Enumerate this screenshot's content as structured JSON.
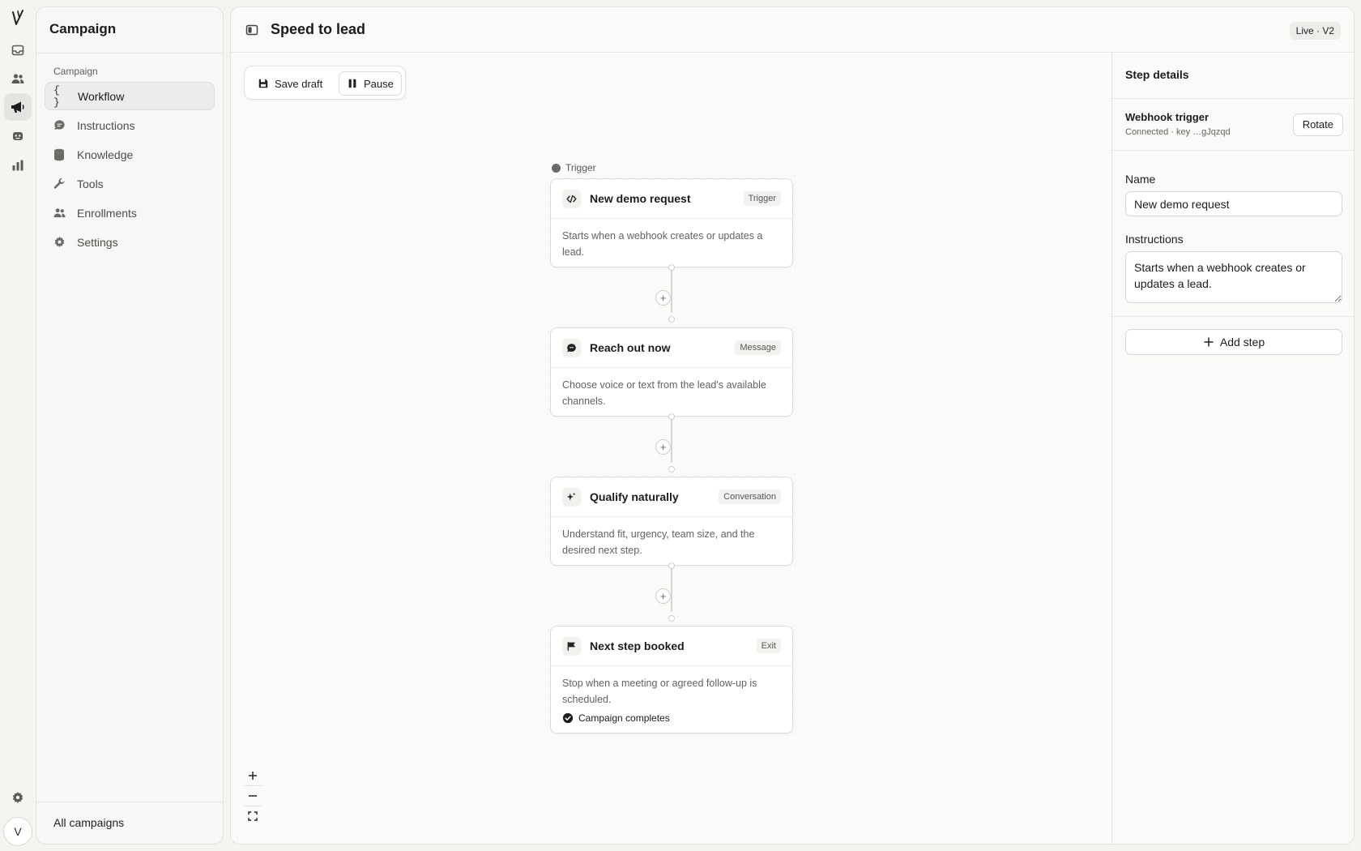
{
  "rail": {
    "logo": "V",
    "icons": [
      "inbox-icon",
      "users-icon",
      "megaphone-icon",
      "bot-icon",
      "chart-icon"
    ],
    "settings_icon": "gear-icon",
    "avatar_letter": "V"
  },
  "sidebar": {
    "title": "Campaign",
    "section": "Campaign",
    "items": [
      {
        "label": "Workflow",
        "icon": "braces-icon",
        "glyph": "{ }",
        "active": true
      },
      {
        "label": "Instructions",
        "icon": "chat-icon",
        "active": false
      },
      {
        "label": "Knowledge",
        "icon": "database-icon",
        "active": false
      },
      {
        "label": "Tools",
        "icon": "wrench-icon",
        "active": false
      },
      {
        "label": "Enrollments",
        "icon": "users-icon",
        "active": false
      },
      {
        "label": "Settings",
        "icon": "gear-icon",
        "active": false
      }
    ],
    "footer_link": "All campaigns"
  },
  "header": {
    "title": "Speed to lead",
    "status": "Live · V2"
  },
  "toolbar": {
    "save_label": "Save draft",
    "pause_label": "Pause"
  },
  "canvas": {
    "trigger_label": "Trigger",
    "nodes": [
      {
        "title": "New demo request",
        "badge": "Trigger",
        "icon": "code-icon",
        "description": "Starts when a webhook creates or updates a lead."
      },
      {
        "title": "Reach out now",
        "badge": "Message",
        "icon": "chat-icon",
        "description": "Choose voice or text from the lead's available channels."
      },
      {
        "title": "Qualify naturally",
        "badge": "Conversation",
        "icon": "sparkles-icon",
        "description": "Understand fit, urgency, team size, and the desired next step."
      },
      {
        "title": "Next step booked",
        "badge": "Exit",
        "icon": "flag-icon",
        "description": "Stop when a meeting or agreed follow-up is scheduled.",
        "completion": "Campaign completes"
      }
    ],
    "zoom": {
      "in": "+",
      "out": "—"
    }
  },
  "details": {
    "heading": "Step details",
    "webhook": {
      "title": "Webhook trigger",
      "subtitle": "Connected · key …gJqzqd",
      "rotate_label": "Rotate"
    },
    "name_label": "Name",
    "name_value": "New demo request",
    "instructions_label": "Instructions",
    "instructions_value": "Starts when a webhook creates or updates a lead.",
    "add_step_label": "Add step"
  }
}
